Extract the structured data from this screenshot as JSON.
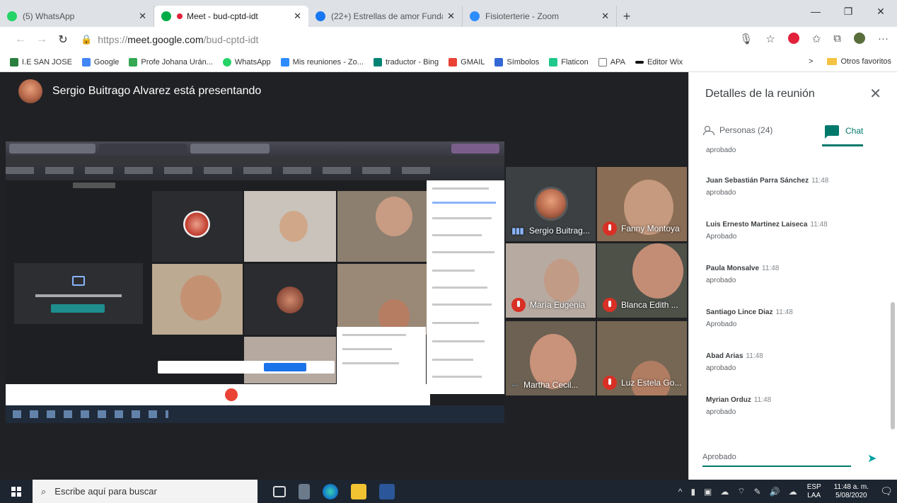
{
  "browser": {
    "tabs": [
      {
        "title": "(5) WhatsApp",
        "active": false,
        "color": "#25d366"
      },
      {
        "title": "Meet - bud-cptd-idt",
        "active": true,
        "color": "#00ac47"
      },
      {
        "title": "(22+) Estrellas de amor Fundaci",
        "active": false,
        "color": "#1877f2"
      },
      {
        "title": "Fisioterterie - Zoom",
        "active": false,
        "color": "#2d8cff"
      }
    ],
    "new_tab": "+",
    "url_prefix": "https://",
    "url_host": "meet.google.com",
    "url_path": "/bud-cptd-idt",
    "bookmarks": [
      {
        "label": "I.E SAN JOSE",
        "color": "#2a7f3e"
      },
      {
        "label": "Google",
        "color": "#4285f4"
      },
      {
        "label": "Profe Johana Urán...",
        "color": "#34a853"
      },
      {
        "label": "WhatsApp",
        "color": "#25d366"
      },
      {
        "label": "Mis reuniones - Zo...",
        "color": "#2d8cff"
      },
      {
        "label": "traductor - Bing",
        "color": "#008373"
      },
      {
        "label": "GMAIL",
        "color": "#ea4335"
      },
      {
        "label": "Símbolos",
        "color": "#3367d6"
      },
      {
        "label": "Flaticon",
        "color": "#1fc98b"
      },
      {
        "label": "APA",
        "color": "#777777"
      },
      {
        "label": "Editor Wix",
        "color": "#111111"
      }
    ],
    "bookmarks_more": ">",
    "other_bookmarks": "Otros favoritos"
  },
  "meet": {
    "presenter_text": "Sergio Buitrago Alvarez está presentando",
    "tiles": [
      {
        "name": "Sergio Buitrag...",
        "muted": false,
        "bg": "#3c4043"
      },
      {
        "name": "Fanny Montoya",
        "muted": true,
        "bg": "#8a6d55"
      },
      {
        "name": "María Eugenia",
        "muted": true,
        "bg": "#b7aaa1"
      },
      {
        "name": "Blanca Edith ...",
        "muted": true,
        "bg": "#4d5148"
      },
      {
        "name": "Martha Cecil...",
        "muted": false,
        "bg": "#6c6152"
      },
      {
        "name": "Luz Estela Go...",
        "muted": true,
        "bg": "#766754"
      }
    ]
  },
  "panel": {
    "title": "Detalles de la reunión",
    "tab_people": "Personas (24)",
    "tab_chat": "Chat",
    "partial_text": "aprobado",
    "messages": [
      {
        "sender": "Juan Sebastián Parra Sánchez",
        "time": "11:48",
        "text": "aprobado"
      },
      {
        "sender": "Luis Ernesto Martinez Laiseca",
        "time": "11:48",
        "text": "Aprobado"
      },
      {
        "sender": "Paula Monsalve",
        "time": "11:48",
        "text": "aprobado"
      },
      {
        "sender": "Santiago Lince Diaz",
        "time": "11:48",
        "text": "Aprobado"
      },
      {
        "sender": "Abad Arias",
        "time": "11:48",
        "text": "aprobado"
      },
      {
        "sender": "Myrian Orduz",
        "time": "11:48",
        "text": "aprobado"
      }
    ],
    "input_value": "Aprobado"
  },
  "taskbar": {
    "search_placeholder": "Escribe aquí para buscar",
    "lang_top": "ESP",
    "lang_bottom": "LAA",
    "time": "11:48 a. m.",
    "date": "5/08/2020"
  }
}
